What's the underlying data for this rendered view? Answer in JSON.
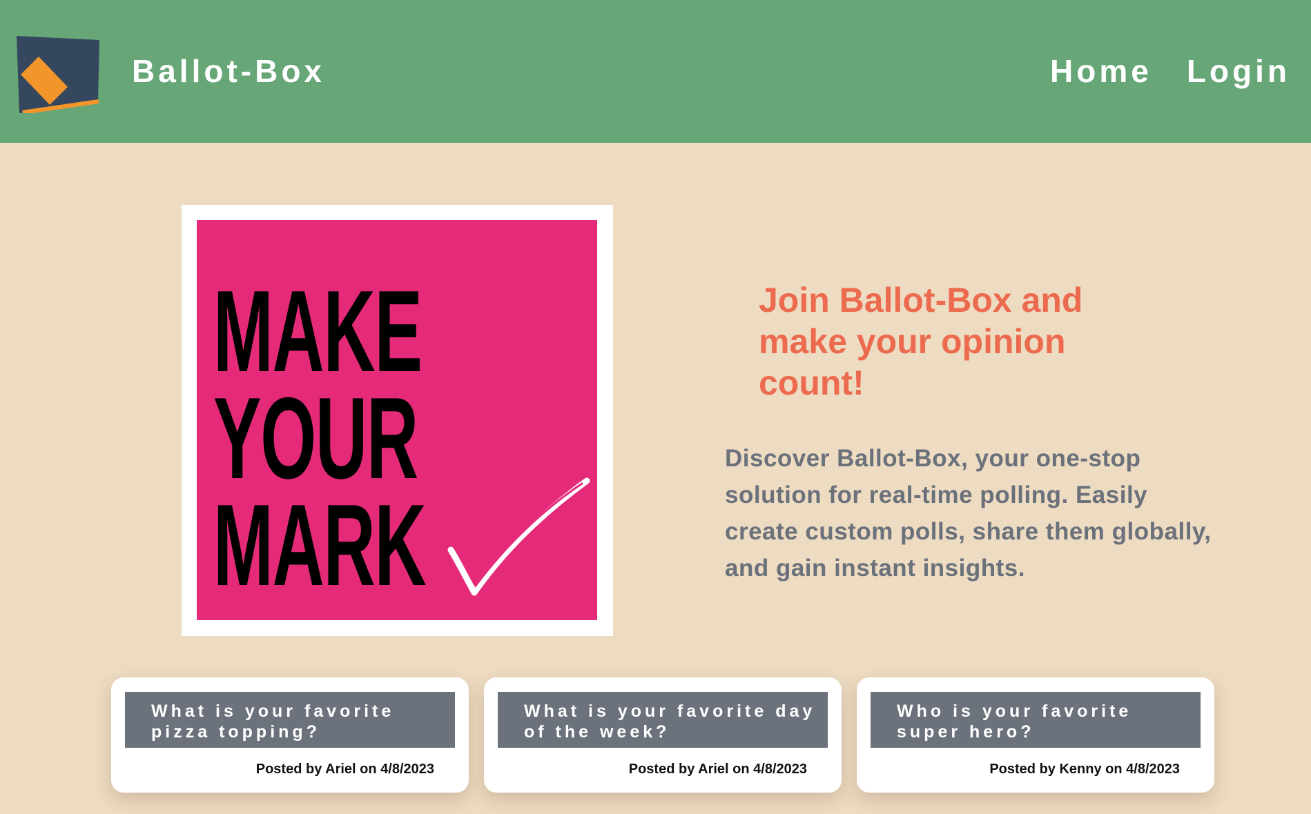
{
  "header": {
    "brand": "Ballot-Box",
    "nav": [
      "Home",
      "Login"
    ],
    "background_color": "#66a677"
  },
  "hero": {
    "poster_lines": [
      "MAKE",
      "YOUR",
      "MARK"
    ],
    "poster_color": "#e52a7a",
    "headline": "Join Ballot-Box and make your opinion count!",
    "description": "Discover Ballot-Box, your one-stop solution for real-time polling. Easily create custom polls, share them globally, and gain instant insights.",
    "headline_color": "#ec6b4f",
    "description_color": "#6a717a"
  },
  "polls": [
    {
      "title": "What is your favorite pizza topping?",
      "meta": "Posted by Ariel on 4/8/2023"
    },
    {
      "title": "What is your favorite day of the week?",
      "meta": "Posted by Ariel on 4/8/2023"
    },
    {
      "title": "Who is your favorite super hero?",
      "meta": "Posted by Kenny on 4/8/2023"
    }
  ],
  "page_background": "#eddbc2"
}
